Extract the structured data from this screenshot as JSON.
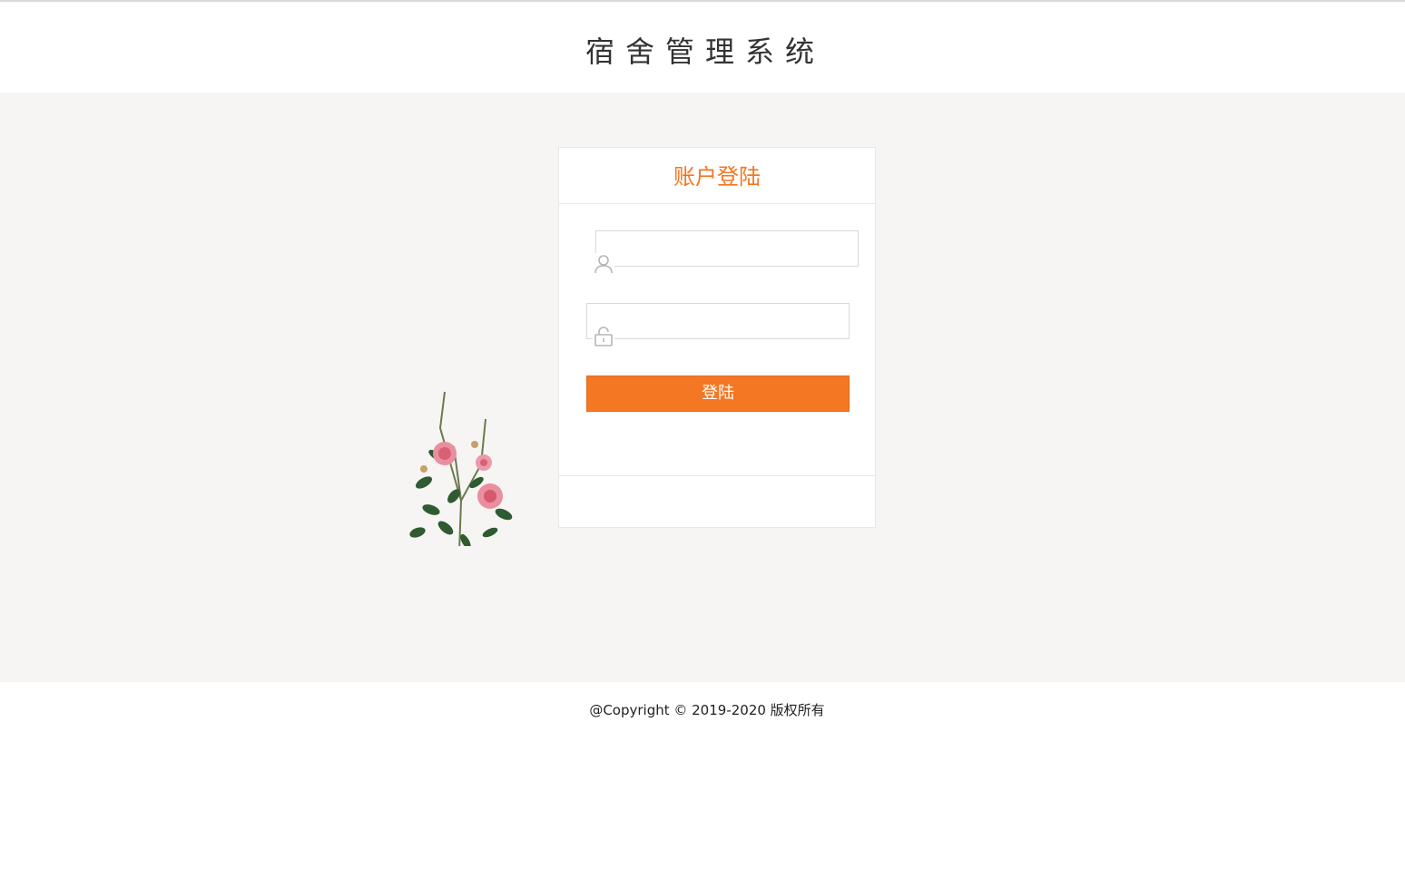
{
  "header": {
    "site_title": "宿舍管理系统"
  },
  "login": {
    "card_title": "账户登陆",
    "username_icon": "user-icon",
    "password_icon": "lock-icon",
    "username_value": "",
    "password_value": "",
    "submit_label": "登陆"
  },
  "footer": {
    "copyright": "@Copyright © 2019-2020 版权所有"
  },
  "colors": {
    "accent": "#f47723",
    "band_background": "#f6f5f3",
    "border": "#e6e9e4"
  }
}
